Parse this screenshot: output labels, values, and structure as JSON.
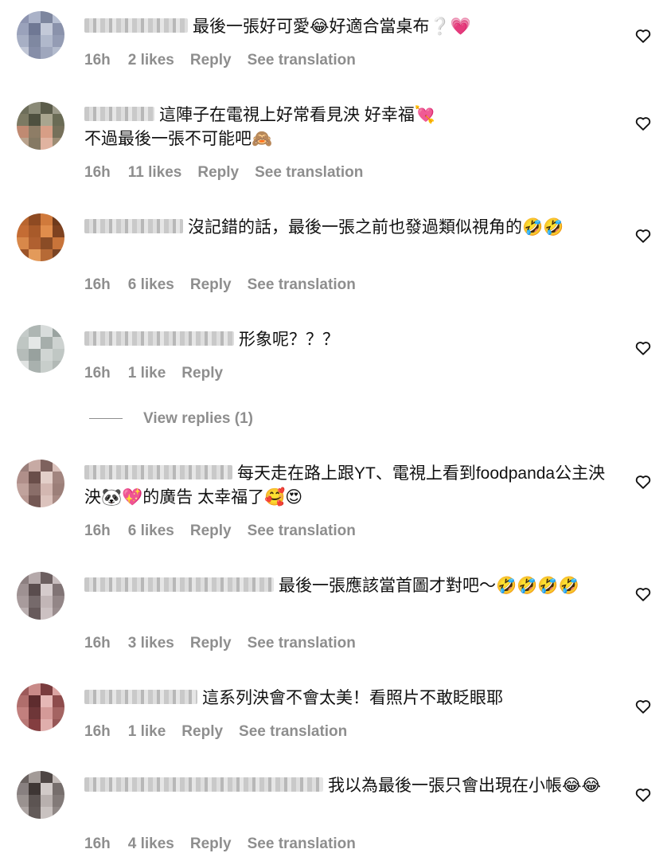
{
  "comments": [
    {
      "text": "最後一張好可愛😂好適合當桌布❔💗",
      "time": "16h",
      "likes": "2 likes",
      "reply": "Reply",
      "translate": "See translation",
      "avatar_colors": [
        "#8d94b0",
        "#aab2c8",
        "#7d869e",
        "#b7bfd2",
        "#9aa2bb",
        "#6f7894",
        "#c3c9d8",
        "#8a92ab",
        "#a7afc4",
        "#7f88a1",
        "#b0b8cb",
        "#949cb4",
        "#c0c6d5",
        "#868ea8",
        "#9fa7bd",
        "#b3bbcd"
      ]
    },
    {
      "text": "這陣子在電視上好常看見泱 好幸福💘\n不過最後一張不可能吧🙈",
      "time": "16h",
      "likes": "11 likes",
      "reply": "Reply",
      "translate": "See translation",
      "avatar_colors": [
        "#6d6e5a",
        "#8a8a77",
        "#5b5c4a",
        "#9b9988",
        "#7c7a63",
        "#4e503f",
        "#a9a58f",
        "#6a6b55",
        "#c08a72",
        "#8e7d66",
        "#d79e86",
        "#76705a",
        "#b9a28c",
        "#857963",
        "#e0b3a0",
        "#9c8c74"
      ]
    },
    {
      "text": "沒記錯的話，最後一張之前也發過類似視角的🤣🤣",
      "time": "16h",
      "likes": "6 likes",
      "reply": "Reply",
      "translate": "See translation",
      "avatar_colors": [
        "#b8652f",
        "#8e4a22",
        "#d07a3c",
        "#6e3a1c",
        "#c46c34",
        "#a85a2a",
        "#e08d4c",
        "#7e4220",
        "#d8884a",
        "#b06030",
        "#8a4c26",
        "#c8743a",
        "#9c5428",
        "#e39a5a",
        "#b66a36",
        "#7a4424"
      ]
    },
    {
      "text": "形象呢？？？",
      "time": "16h",
      "likes": "1 like",
      "reply": "Reply",
      "translate": "",
      "avatar_colors": [
        "#c5cbc9",
        "#aeb6b3",
        "#d8dcdb",
        "#9aa3a0",
        "#bfc6c3",
        "#e4e7e6",
        "#a6aeab",
        "#cdd2d0",
        "#b5bcb9",
        "#98a19e",
        "#d0d5d3",
        "#c0c7c4",
        "#e0e3e2",
        "#a9b1ae",
        "#c8cecb",
        "#b2b9b6"
      ]
    },
    {
      "text": "每天走在路上跟YT、電視上看到foodpanda公主泱泱🐼💖的廣告 太幸福了🥰😍",
      "time": "16h",
      "likes": "6 likes",
      "reply": "Reply",
      "translate": "See translation",
      "avatar_colors": [
        "#9a7e7a",
        "#c7aaa4",
        "#7e625e",
        "#d9c0ba",
        "#b08f8a",
        "#6a4e4a",
        "#e3cfc9",
        "#a2857f",
        "#c0a29c",
        "#8a6e69",
        "#d3b7b1",
        "#9c7f79",
        "#b89892",
        "#745854",
        "#dcc3bd",
        "#a88a84"
      ]
    },
    {
      "text": "最後一張應該當首圖才對吧～🤣🤣🤣🤣",
      "time": "16h",
      "likes": "3 likes",
      "reply": "Reply",
      "translate": "See translation",
      "avatar_colors": [
        "#8c7f80",
        "#b5a9aa",
        "#6c5f60",
        "#c8bdbe",
        "#9e9192",
        "#5a4d4e",
        "#d5cbcc",
        "#817475",
        "#a89b9c",
        "#766a6b",
        "#c2b6b7",
        "#938687",
        "#b9aeaf",
        "#675a5b",
        "#ccc1c2",
        "#9a8d8e"
      ]
    },
    {
      "text": "這系列泱會不會太美！看照片不敢眨眼耶",
      "time": "16h",
      "likes": "1 like",
      "reply": "Reply",
      "translate": "See translation",
      "avatar_colors": [
        "#9c5a5a",
        "#c98a88",
        "#7a3c3e",
        "#dba4a2",
        "#b06e6c",
        "#5e2c2e",
        "#e6b8b6",
        "#8e4c4c",
        "#c2807e",
        "#6e3638",
        "#d49a98",
        "#a46462",
        "#b87876",
        "#843e40",
        "#e0aeac",
        "#965656"
      ]
    },
    {
      "text": "我以為最後一張只會出現在小帳😂😂",
      "time": "16h",
      "likes": "4 likes",
      "reply": "Reply",
      "translate": "See translation",
      "avatar_colors": [
        "#6a6260",
        "#a39b98",
        "#4e4644",
        "#c2bab7",
        "#888080",
        "#3e3634",
        "#d1cac8",
        "#766e6c",
        "#9a9290",
        "#5c5452",
        "#b8b0ae",
        "#827a78",
        "#aca4a2",
        "#625a58",
        "#c9c2c0",
        "#908886"
      ]
    }
  ],
  "view_replies": "View replies (1)"
}
